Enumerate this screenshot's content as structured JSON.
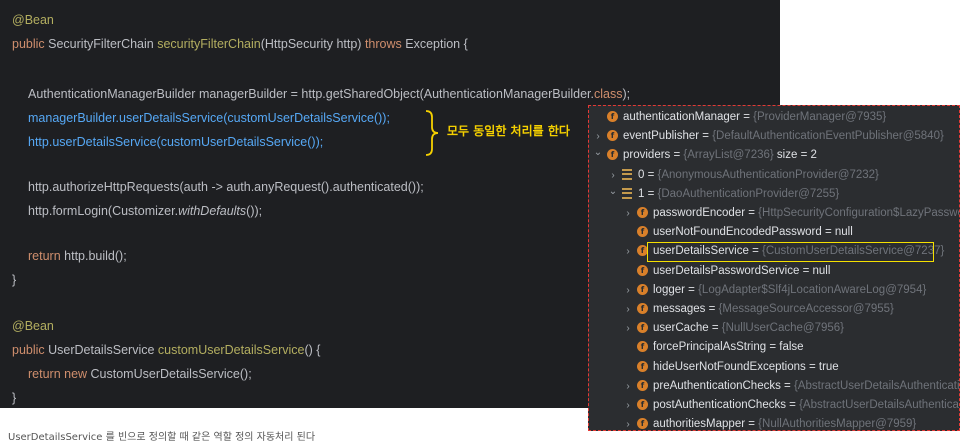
{
  "code": {
    "line1": "@Bean",
    "line2_kw": "public ",
    "line2_type": "SecurityFilterChain ",
    "line2_fn": "securityFilterChain",
    "line2_params": "(HttpSecurity http) ",
    "line2_throws": "throws ",
    "line2_exc": "Exception {",
    "line3_a": "AuthenticationManagerBuilder managerBuilder = http.getSharedObject(AuthenticationManagerBuilder.",
    "line3_b": "class",
    "line3_c": ");",
    "line4": "managerBuilder.userDetailsService(customUserDetailsService());",
    "line5": "http.userDetailsService(customUserDetailsService());",
    "line6": "http.authorizeHttpRequests(auth -> auth.anyRequest().authenticated());",
    "line7_a": "http.formLogin(Customizer.",
    "line7_b": "withDefaults",
    "line7_c": "());",
    "line8_kw": "return ",
    "line8_rest": "http.build();",
    "line9": "}",
    "line10": "@Bean",
    "line11_kw": "public ",
    "line11_type": "UserDetailsService ",
    "line11_fn": "customUserDetailsService",
    "line11_rest": "() {",
    "line12_kw": "return new ",
    "line12_rest": "CustomUserDetailsService();",
    "line13": "}"
  },
  "annotation": {
    "brace_label": "모두 동일한 처리를 한다",
    "brace_color": "#f5d000"
  },
  "debugger": {
    "highlight_color": "#f5e000",
    "rows": [
      {
        "chev": "",
        "icon": "f",
        "name": "authenticationManager",
        "eq": " = ",
        "val": "{ProviderManager@7935}"
      },
      {
        "chev": ">",
        "icon": "f",
        "name": "eventPublisher",
        "eq": " = ",
        "val": "{DefaultAuthenticationEventPublisher@5840}"
      },
      {
        "chev": "v",
        "icon": "f",
        "name": "providers",
        "eq": " = ",
        "val": "{ArrayList@7236}",
        "extra": "  size = 2"
      },
      {
        "chev": ">",
        "icon": "list",
        "name": "0",
        "eq": " = ",
        "val": "{AnonymousAuthenticationProvider@7232}"
      },
      {
        "chev": "v",
        "icon": "list",
        "name": "1",
        "eq": " = ",
        "val": "{DaoAuthenticationProvider@7255}"
      },
      {
        "chev": ">",
        "icon": "f",
        "name": "passwordEncoder",
        "eq": " = ",
        "val": "{HttpSecurityConfiguration$LazyPasswor"
      },
      {
        "chev": "",
        "icon": "f",
        "name": "userNotFoundEncodedPassword",
        "eq": " = ",
        "plain": "null"
      },
      {
        "chev": ">",
        "icon": "f",
        "name": "userDetailsService",
        "eq": " = ",
        "val": "{CustomUserDetailsService@7237}"
      },
      {
        "chev": "",
        "icon": "f",
        "name": "userDetailsPasswordService",
        "eq": " = ",
        "plain": "null"
      },
      {
        "chev": ">",
        "icon": "f",
        "name": "logger",
        "eq": " = ",
        "val": "{LogAdapter$Slf4jLocationAwareLog@7954}"
      },
      {
        "chev": ">",
        "icon": "f",
        "name": "messages",
        "eq": " = ",
        "val": "{MessageSourceAccessor@7955}"
      },
      {
        "chev": ">",
        "icon": "f",
        "name": "userCache",
        "eq": " = ",
        "val": "{NullUserCache@7956}"
      },
      {
        "chev": "",
        "icon": "f",
        "name": "forcePrincipalAsString",
        "eq": " = ",
        "plain": "false"
      },
      {
        "chev": "",
        "icon": "f",
        "name": "hideUserNotFoundExceptions",
        "eq": " = ",
        "plain": "true"
      },
      {
        "chev": ">",
        "icon": "f",
        "name": "preAuthenticationChecks",
        "eq": " = ",
        "val": "{AbstractUserDetailsAuthenticatio"
      },
      {
        "chev": ">",
        "icon": "f",
        "name": "postAuthenticationChecks",
        "eq": " = ",
        "val": "{AbstractUserDetailsAuthenticat"
      },
      {
        "chev": ">",
        "icon": "f",
        "name": "authoritiesMapper",
        "eq": " = ",
        "val": "{NullAuthoritiesMapper@7959}"
      }
    ]
  },
  "caption": "UserDetailsService 를 빈으로 정의할 때 같은 역할 정의 자동처리 된다"
}
